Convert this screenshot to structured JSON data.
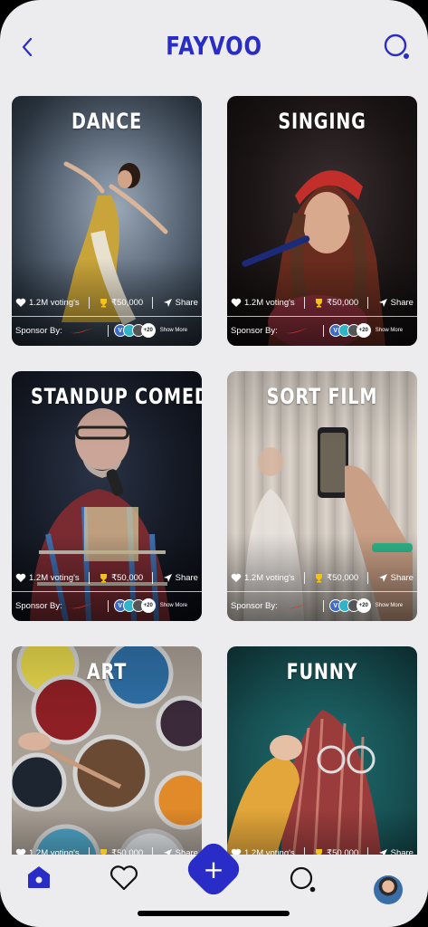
{
  "header": {
    "title": "FAYVOO"
  },
  "cards": [
    {
      "title": "DANCE",
      "votes": "1.2M voting's",
      "prize": "₹50,000",
      "share": "Share",
      "sponsor_label": "Sponsor By:",
      "more_count": "+20",
      "show_more": "Show More"
    },
    {
      "title": "SINGING",
      "votes": "1.2M voting's",
      "prize": "₹50,000",
      "share": "Share",
      "sponsor_label": "Sponsor By:",
      "more_count": "+20",
      "show_more": "Show More"
    },
    {
      "title": "STANDUP COMEDY",
      "votes": "1.2M voting's",
      "prize": "₹50,000",
      "share": "Share",
      "sponsor_label": "Sponsor By:",
      "more_count": "+20",
      "show_more": "Show More"
    },
    {
      "title": "SORT FILM",
      "votes": "1.2M voting's",
      "prize": "₹50,000",
      "share": "Share",
      "sponsor_label": "Sponsor By:",
      "more_count": "+20",
      "show_more": "Show More"
    },
    {
      "title": "ART",
      "votes": "1.2M voting's",
      "prize": "₹50,000",
      "share": "Share"
    },
    {
      "title": "FUNNY",
      "votes": "1.2M voting's",
      "prize": "₹50,000",
      "share": "Share"
    }
  ],
  "nav": {
    "items": [
      "home-icon",
      "heart-icon",
      "add-icon",
      "search-icon",
      "avatar"
    ],
    "fab_label": "+"
  },
  "colors": {
    "accent": "#2a2cc7",
    "background": "#ececee"
  }
}
